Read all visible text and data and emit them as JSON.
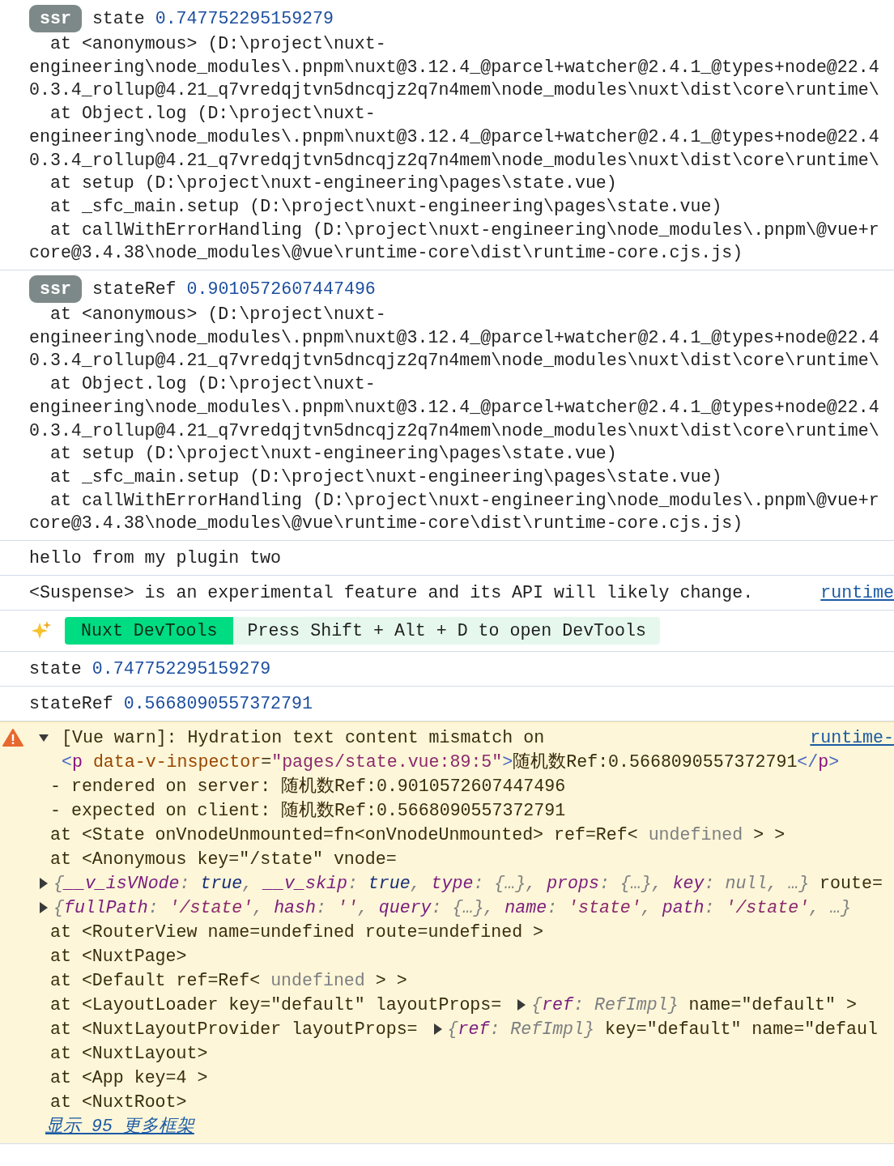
{
  "messages": [
    {
      "kind": "log",
      "badge": "ssr",
      "tokens": [
        {
          "kind": "text",
          "text": "state"
        },
        {
          "kind": "number",
          "text": "0.747752295159279"
        }
      ],
      "stack": [
        [
          "at <anonymous> (D:\\project\\nuxt-",
          "engineering\\node_modules\\.pnpm\\nuxt@3.12.4_@parcel+watcher@2.4.1_@types+node@22.4",
          "0.3.4_rollup@4.21_q7vredqjtvn5dncqjz2q7n4mem\\node_modules\\nuxt\\dist\\core\\runtime\\"
        ],
        [
          "at Object.log (D:\\project\\nuxt-",
          "engineering\\node_modules\\.pnpm\\nuxt@3.12.4_@parcel+watcher@2.4.1_@types+node@22.4",
          "0.3.4_rollup@4.21_q7vredqjtvn5dncqjz2q7n4mem\\node_modules\\nuxt\\dist\\core\\runtime\\"
        ],
        [
          "at setup (D:\\project\\nuxt-engineering\\pages\\state.vue)"
        ],
        [
          "at _sfc_main.setup (D:\\project\\nuxt-engineering\\pages\\state.vue)"
        ],
        [
          "at callWithErrorHandling (D:\\project\\nuxt-engineering\\node_modules\\.pnpm\\@vue+r",
          "core@3.4.38\\node_modules\\@vue\\runtime-core\\dist\\runtime-core.cjs.js)"
        ]
      ]
    },
    {
      "kind": "log",
      "badge": "ssr",
      "tokens": [
        {
          "kind": "text",
          "text": "stateRef"
        },
        {
          "kind": "number",
          "text": "0.9010572607447496"
        }
      ],
      "stack": [
        [
          "at <anonymous> (D:\\project\\nuxt-",
          "engineering\\node_modules\\.pnpm\\nuxt@3.12.4_@parcel+watcher@2.4.1_@types+node@22.4",
          "0.3.4_rollup@4.21_q7vredqjtvn5dncqjz2q7n4mem\\node_modules\\nuxt\\dist\\core\\runtime\\"
        ],
        [
          "at Object.log (D:\\project\\nuxt-",
          "engineering\\node_modules\\.pnpm\\nuxt@3.12.4_@parcel+watcher@2.4.1_@types+node@22.4",
          "0.3.4_rollup@4.21_q7vredqjtvn5dncqjz2q7n4mem\\node_modules\\nuxt\\dist\\core\\runtime\\"
        ],
        [
          "at setup (D:\\project\\nuxt-engineering\\pages\\state.vue)"
        ],
        [
          "at _sfc_main.setup (D:\\project\\nuxt-engineering\\pages\\state.vue)"
        ],
        [
          "at callWithErrorHandling (D:\\project\\nuxt-engineering\\node_modules\\.pnpm\\@vue+r",
          "core@3.4.38\\node_modules\\@vue\\runtime-core\\dist\\runtime-core.cjs.js)"
        ]
      ]
    },
    {
      "kind": "log",
      "tokens": [
        {
          "kind": "text",
          "text": "hello from my plugin two"
        }
      ]
    },
    {
      "kind": "log",
      "tokens": [
        {
          "kind": "text",
          "text": "<Suspense> is an experimental feature and its API will likely change."
        }
      ],
      "link": "runtime"
    },
    {
      "kind": "devtools",
      "tag": "Nuxt DevTools",
      "text": "Press Shift + Alt + D to open DevTools"
    },
    {
      "kind": "log",
      "tokens": [
        {
          "kind": "text",
          "text": "state"
        },
        {
          "kind": "number",
          "text": "0.747752295159279"
        }
      ]
    },
    {
      "kind": "log",
      "tokens": [
        {
          "kind": "text",
          "text": "stateRef"
        },
        {
          "kind": "number",
          "text": "0.5668090557372791"
        }
      ]
    },
    {
      "kind": "warning",
      "expanded": true,
      "header": "[Vue warn]: Hydration text content mismatch on",
      "link": "runtime-",
      "lines": [
        {
          "kind": "html",
          "tokens": [
            {
              "kind": "tag-punct",
              "text": "<"
            },
            {
              "kind": "tag-name",
              "text": "p"
            },
            {
              "kind": "attr-name",
              "text": " data-v-inspector"
            },
            {
              "kind": "text",
              "text": "="
            },
            {
              "kind": "attr-value",
              "text": "\"pages/state.vue:89:5\""
            },
            {
              "kind": "tag-punct",
              "text": ">"
            },
            {
              "kind": "text",
              "text": "随机数Ref:0.5668090557372791"
            },
            {
              "kind": "tag-punct",
              "text": "</"
            },
            {
              "kind": "tag-name",
              "text": "p"
            },
            {
              "kind": "tag-punct",
              "text": ">"
            }
          ]
        },
        {
          "kind": "text",
          "tokens": [
            {
              "kind": "text",
              "text": "- rendered on server: 随机数Ref:0.9010572607447496"
            }
          ]
        },
        {
          "kind": "text",
          "tokens": [
            {
              "kind": "text",
              "text": "- expected on client: 随机数Ref:0.5668090557372791"
            }
          ]
        },
        {
          "kind": "text",
          "tokens": [
            {
              "kind": "text",
              "text": "at <State onVnodeUnmounted=fn<onVnodeUnmounted> ref=Ref< "
            },
            {
              "kind": "muted",
              "text": "undefined"
            },
            {
              "kind": "text",
              "text": " > >"
            }
          ]
        },
        {
          "kind": "text",
          "tokens": [
            {
              "kind": "text",
              "text": "at <Anonymous key=\"/state\" vnode="
            }
          ]
        },
        {
          "kind": "object",
          "tokens": [
            {
              "kind": "caret",
              "expanded": false
            },
            {
              "kind": "punct",
              "text": "{"
            },
            {
              "kind": "key",
              "text": "__v_isVNode"
            },
            {
              "kind": "punct",
              "text": ": "
            },
            {
              "kind": "bool",
              "text": "true"
            },
            {
              "kind": "punct",
              "text": ", "
            },
            {
              "kind": "key",
              "text": "__v_skip"
            },
            {
              "kind": "punct",
              "text": ": "
            },
            {
              "kind": "bool",
              "text": "true"
            },
            {
              "kind": "punct",
              "text": ", "
            },
            {
              "kind": "key",
              "text": "type"
            },
            {
              "kind": "punct",
              "text": ": {…}, "
            },
            {
              "kind": "key",
              "text": "props"
            },
            {
              "kind": "punct",
              "text": ": {…}, "
            },
            {
              "kind": "key",
              "text": "key"
            },
            {
              "kind": "punct",
              "text": ": "
            },
            {
              "kind": "null",
              "text": "null"
            },
            {
              "kind": "punct",
              "text": ", …}"
            },
            {
              "kind": "text",
              "text": " route="
            }
          ]
        },
        {
          "kind": "object",
          "tokens": [
            {
              "kind": "caret",
              "expanded": false
            },
            {
              "kind": "punct",
              "text": "{"
            },
            {
              "kind": "key",
              "text": "fullPath"
            },
            {
              "kind": "punct",
              "text": ": "
            },
            {
              "kind": "string",
              "text": "'/state'"
            },
            {
              "kind": "punct",
              "text": ", "
            },
            {
              "kind": "key",
              "text": "hash"
            },
            {
              "kind": "punct",
              "text": ": "
            },
            {
              "kind": "string",
              "text": "''"
            },
            {
              "kind": "punct",
              "text": ", "
            },
            {
              "kind": "key",
              "text": "query"
            },
            {
              "kind": "punct",
              "text": ": {…}, "
            },
            {
              "kind": "key",
              "text": "name"
            },
            {
              "kind": "punct",
              "text": ": "
            },
            {
              "kind": "string",
              "text": "'state'"
            },
            {
              "kind": "punct",
              "text": ", "
            },
            {
              "kind": "key",
              "text": "path"
            },
            {
              "kind": "punct",
              "text": ": "
            },
            {
              "kind": "string",
              "text": "'/state'"
            },
            {
              "kind": "punct",
              "text": ", …}"
            }
          ]
        },
        {
          "kind": "text",
          "tokens": [
            {
              "kind": "text",
              "text": "at <RouterView name=undefined route=undefined >"
            }
          ]
        },
        {
          "kind": "text",
          "tokens": [
            {
              "kind": "text",
              "text": "at <NuxtPage>"
            }
          ]
        },
        {
          "kind": "text",
          "tokens": [
            {
              "kind": "text",
              "text": "at <Default ref=Ref< "
            },
            {
              "kind": "muted",
              "text": "undefined"
            },
            {
              "kind": "text",
              "text": " > >"
            }
          ]
        },
        {
          "kind": "text",
          "tokens": [
            {
              "kind": "text",
              "text": "at <LayoutLoader key=\"default\" layoutProps= "
            },
            {
              "kind": "caret",
              "expanded": false
            },
            {
              "kind": "punct",
              "text": "{"
            },
            {
              "kind": "key",
              "text": "ref"
            },
            {
              "kind": "punct",
              "text": ": "
            },
            {
              "kind": "null",
              "text": "RefImpl"
            },
            {
              "kind": "punct",
              "text": "}"
            },
            {
              "kind": "text",
              "text": " name=\"default\" >"
            }
          ]
        },
        {
          "kind": "text",
          "tokens": [
            {
              "kind": "text",
              "text": "at <NuxtLayoutProvider layoutProps= "
            },
            {
              "kind": "caret",
              "expanded": false
            },
            {
              "kind": "punct",
              "text": "{"
            },
            {
              "kind": "key",
              "text": "ref"
            },
            {
              "kind": "punct",
              "text": ": "
            },
            {
              "kind": "null",
              "text": "RefImpl"
            },
            {
              "kind": "punct",
              "text": "}"
            },
            {
              "kind": "text",
              "text": " key=\"default\" name=\"defaul"
            }
          ]
        },
        {
          "kind": "text",
          "tokens": [
            {
              "kind": "text",
              "text": "at <NuxtLayout>"
            }
          ]
        },
        {
          "kind": "text",
          "tokens": [
            {
              "kind": "text",
              "text": "at <App key=4 >"
            }
          ]
        },
        {
          "kind": "text",
          "tokens": [
            {
              "kind": "text",
              "text": "at <NuxtRoot>"
            }
          ]
        }
      ],
      "more_link": "显示 95 更多框架"
    }
  ]
}
